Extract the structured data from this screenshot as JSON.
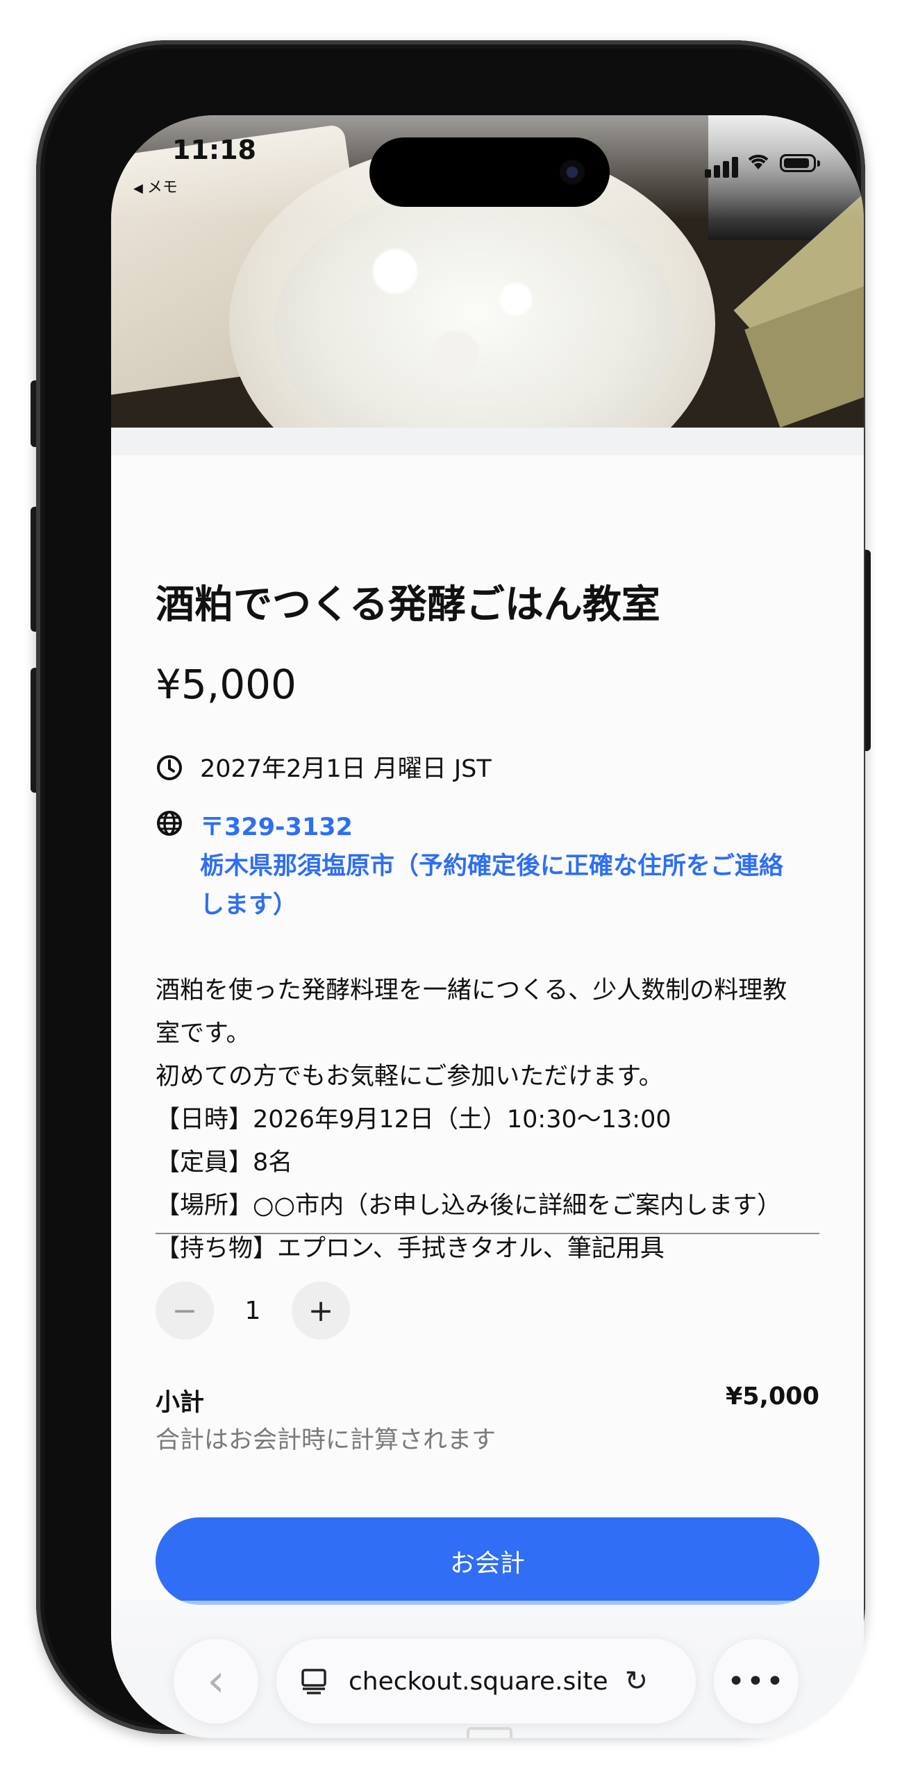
{
  "status_bar": {
    "time": "11:18",
    "back_app": "メモ"
  },
  "event": {
    "title": "酒粕でつくる発酵ごはん教室",
    "price": "¥5,000",
    "datetime": "2027年2月1日 月曜日 JST",
    "postal_code": "〒329-3132",
    "address_line1": "栃木県那須塩原市（予約確定後に正確な住所をご連絡",
    "address_line2": "します）",
    "description": [
      "酒粕を使った発酵料理を一緒につくる、少人数制の料理教",
      "室です。",
      "初めての方でもお気軽にご参加いただけます。",
      "【日時】2026年9月12日（土）10:30〜13:00",
      "【定員】8名",
      "【場所】○○市内（お申し込み後に詳細をご案内します）",
      "【持ち物】エプロン、手拭きタオル、筆記用具"
    ]
  },
  "quantity": {
    "minus_symbol": "−",
    "value": "1",
    "plus_symbol": "+"
  },
  "subtotal": {
    "label": "小計",
    "value": "¥5,000",
    "note": "合計はお会計時に計算されます"
  },
  "checkout_button": "お会計",
  "browser": {
    "url": "checkout.square.site",
    "back_symbol": "‹",
    "more_symbol": "•••",
    "reload_symbol": "↻"
  },
  "icons": {
    "datetime": "clock-icon",
    "location": "globe-icon",
    "tab": "tab-overview-icon"
  },
  "colors": {
    "accent": "#2f6ef5",
    "link": "#2d6ef5",
    "muted_text": "#7a7a7a"
  }
}
